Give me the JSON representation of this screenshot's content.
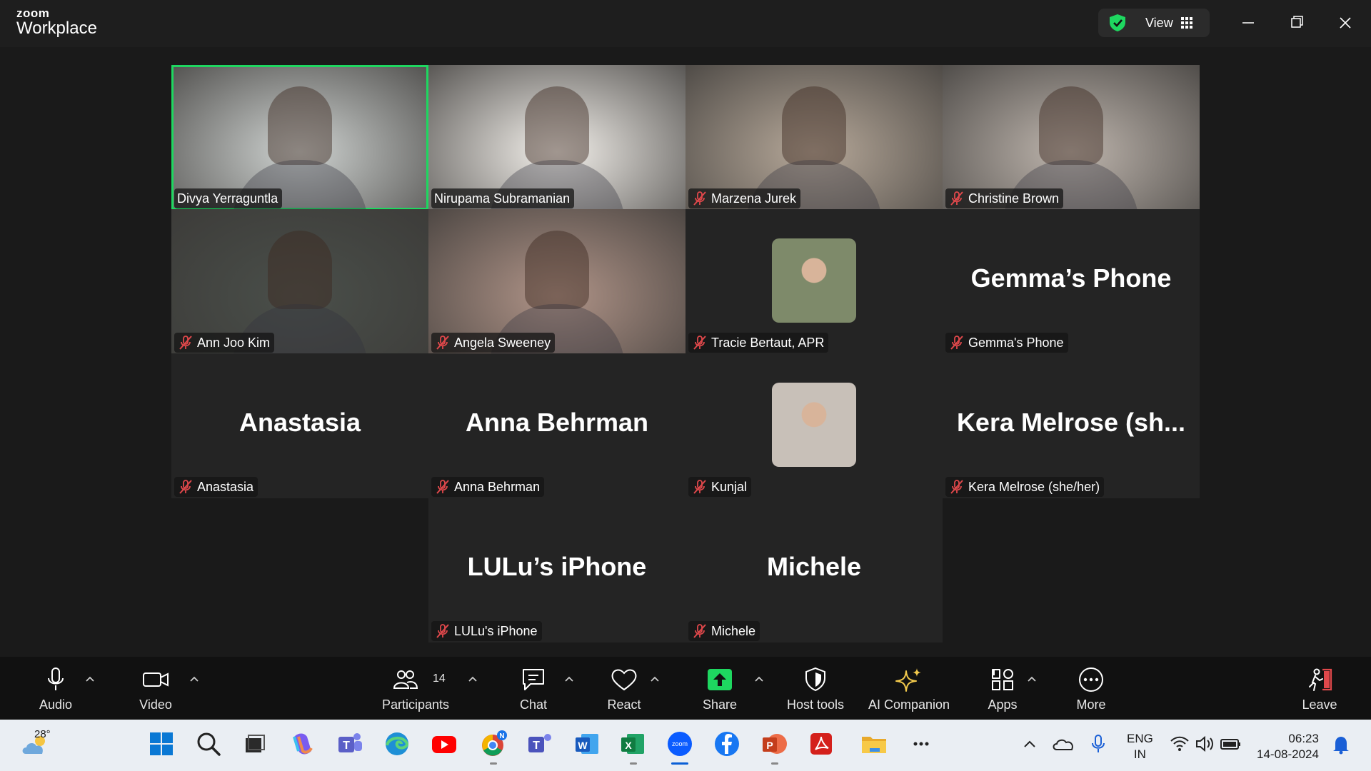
{
  "app": {
    "brand_top": "zoom",
    "brand_bottom": "Workplace"
  },
  "titlebar": {
    "view_label": "View"
  },
  "tiles": [
    {
      "name": "Divya Yerraguntla",
      "kind": "video",
      "muted": false,
      "active": true,
      "bg": "#cfd3d1"
    },
    {
      "name": "Nirupama Subramanian",
      "kind": "video",
      "muted": false,
      "active": false,
      "bg": "#f4f1ec"
    },
    {
      "name": "Marzena Jurek",
      "kind": "video",
      "muted": true,
      "active": false,
      "bg": "#b7a99a"
    },
    {
      "name": "Christine Brown",
      "kind": "video",
      "muted": true,
      "active": false,
      "bg": "#bfb6ae"
    },
    {
      "name": "Ann Joo Kim",
      "kind": "video",
      "muted": true,
      "active": false,
      "bg": "#4a4f4a"
    },
    {
      "name": "Angela Sweeney",
      "kind": "video",
      "muted": true,
      "active": false,
      "bg": "#b09488"
    },
    {
      "name": "Tracie Bertaut, APR",
      "kind": "avatar",
      "muted": true,
      "active": false,
      "bg": "#7e8a6a"
    },
    {
      "name": "Gemma's Phone",
      "display": "Gemma’s Phone",
      "kind": "text",
      "muted": true,
      "active": false
    },
    {
      "name": "Anastasia",
      "display": "Anastasia",
      "kind": "text",
      "muted": true,
      "active": false
    },
    {
      "name": "Anna Behrman",
      "display": "Anna Behrman",
      "kind": "text",
      "muted": true,
      "active": false
    },
    {
      "name": "Kunjal",
      "kind": "avatar",
      "muted": true,
      "active": false,
      "bg": "#c8c0b8"
    },
    {
      "name": "Kera Melrose (she/her)",
      "display": "Kera Melrose (sh...",
      "kind": "text",
      "muted": true,
      "active": false
    },
    {
      "name": "LULu's iPhone",
      "display": "LULu’s iPhone",
      "kind": "text",
      "muted": true,
      "active": false
    },
    {
      "name": "Michele",
      "display": "Michele",
      "kind": "text",
      "muted": true,
      "active": false
    }
  ],
  "toolbar": {
    "audio": "Audio",
    "video": "Video",
    "participants": "Participants",
    "participant_count": "14",
    "chat": "Chat",
    "react": "React",
    "share": "Share",
    "host_tools": "Host tools",
    "ai_companion": "AI Companion",
    "apps": "Apps",
    "more": "More",
    "leave": "Leave"
  },
  "taskbar": {
    "temperature": "28°",
    "lang_top": "ENG",
    "lang_bottom": "IN",
    "time": "06:23",
    "date": "14-08-2024",
    "chrome_badge": "N"
  },
  "colors": {
    "active_border": "#1ed760",
    "share_green": "#1ed760",
    "mute_red": "#e0484b",
    "leave_red": "#e0484b"
  }
}
